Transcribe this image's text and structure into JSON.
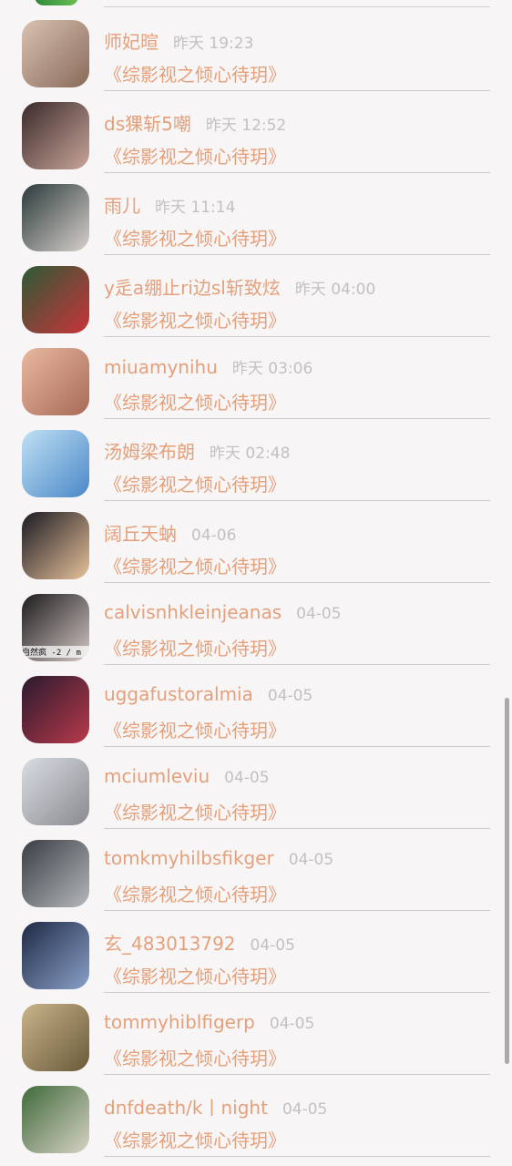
{
  "comments": [
    {
      "name": "师妃暄",
      "time": "昨天 19:23",
      "book": "《综影视之倾心待玥》",
      "avatar_colors": [
        "#d8c2b0",
        "#8a6a5a"
      ]
    },
    {
      "name": "ds猓斩5嘲",
      "time": "昨天 12:52",
      "book": "《综影视之倾心待玥》",
      "avatar_colors": [
        "#3a2a2a",
        "#c9a59a"
      ]
    },
    {
      "name": "雨儿",
      "time": "昨天 11:14",
      "book": "《综影视之倾心待玥》",
      "avatar_colors": [
        "#2a3a3a",
        "#d8d0cc"
      ]
    },
    {
      "name": "y辵a绷止ri边sl斩致炫",
      "time": "昨天 04:00",
      "book": "《综影视之倾心待玥》",
      "avatar_colors": [
        "#2d5a36",
        "#c9343a"
      ]
    },
    {
      "name": "miuamynihu",
      "time": "昨天 03:06",
      "book": "《综影视之倾心待玥》",
      "avatar_colors": [
        "#e8b8a0",
        "#a86a58"
      ]
    },
    {
      "name": "汤姆梁布朗",
      "time": "昨天 02:48",
      "book": "《综影视之倾心待玥》",
      "avatar_colors": [
        "#bfe0f4",
        "#4a88c8"
      ]
    },
    {
      "name": "阔丘天蚋",
      "time": "04-06",
      "book": "《综影视之倾心待玥》",
      "avatar_colors": [
        "#1a1a22",
        "#e8c29a"
      ]
    },
    {
      "name": "calvisnhkleinjeanas",
      "time": "04-05",
      "book": "《综影视之倾心待玥》",
      "avatar_colors": [
        "#1c1c1c",
        "#d4c8c4"
      ]
    },
    {
      "name": "uggafustoralmia",
      "time": "04-05",
      "book": "《综影视之倾心待玥》",
      "avatar_colors": [
        "#2a1a2e",
        "#b83a4a"
      ]
    },
    {
      "name": "mciumleviu",
      "time": "04-05",
      "book": "《综影视之倾心待玥》",
      "avatar_colors": [
        "#d8dde2",
        "#8a8a90"
      ]
    },
    {
      "name": "tomkmyhilbsfikger",
      "time": "04-05",
      "book": "《综影视之倾心待玥》",
      "avatar_colors": [
        "#3a3e44",
        "#b4b8bc"
      ]
    },
    {
      "name": "玄_483013792",
      "time": "04-05",
      "book": "《综影视之倾心待玥》",
      "avatar_colors": [
        "#1e2a44",
        "#8aa0c8"
      ]
    },
    {
      "name": "tommyhiblfigerp",
      "time": "04-05",
      "book": "《综影视之倾心待玥》",
      "avatar_colors": [
        "#c8b48a",
        "#6a5a3a"
      ]
    },
    {
      "name": "dnfdeath/k丨night",
      "time": "04-05",
      "book": "《综影视之倾心待玥》",
      "avatar_colors": [
        "#3e6a3a",
        "#d8d2c4"
      ]
    }
  ],
  "avatar_overlay_text": "自然疯 -2 / m"
}
